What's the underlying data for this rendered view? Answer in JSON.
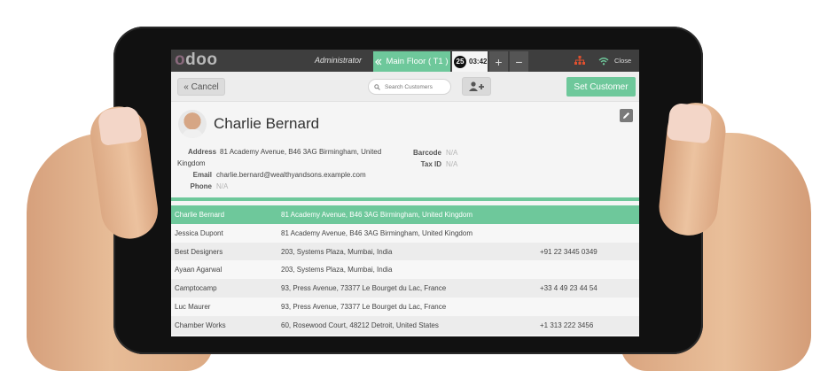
{
  "topbar": {
    "logo_a": "o",
    "logo_b": "doo",
    "user": "Administrator",
    "floor_tab": "Main Floor ( T1 )",
    "order_number": "25",
    "order_time": "03:42",
    "plus_label": "+",
    "minus_label": "−",
    "close_label": "Close"
  },
  "toolbar": {
    "cancel_label": "« Cancel",
    "search_placeholder": "Search Customers",
    "set_customer_label": "Set Customer"
  },
  "customer": {
    "name": "Charlie Bernard",
    "address_label": "Address",
    "address": "81 Academy Avenue, B46 3AG Birmingham, United Kingdom",
    "email_label": "Email",
    "email": "charlie.bernard@wealthyandsons.example.com",
    "phone_label": "Phone",
    "phone": "N/A",
    "barcode_label": "Barcode",
    "barcode": "N/A",
    "taxid_label": "Tax ID",
    "taxid": "N/A"
  },
  "customers": [
    {
      "name": "Charlie Bernard",
      "address": "81 Academy Avenue, B46 3AG Birmingham, United Kingdom",
      "phone": ""
    },
    {
      "name": "Jessica Dupont",
      "address": "81 Academy Avenue, B46 3AG Birmingham, United Kingdom",
      "phone": ""
    },
    {
      "name": "Best Designers",
      "address": "203, Systems Plaza, Mumbai, India",
      "phone": "+91 22 3445 0349"
    },
    {
      "name": "Ayaan Agarwal",
      "address": "203, Systems Plaza, Mumbai, India",
      "phone": ""
    },
    {
      "name": "Camptocamp",
      "address": "93, Press Avenue, 73377 Le Bourget du Lac, France",
      "phone": "+33 4 49 23 44 54"
    },
    {
      "name": "Luc Maurer",
      "address": "93, Press Avenue, 73377 Le Bourget du Lac, France",
      "phone": ""
    },
    {
      "name": "Chamber Works",
      "address": "60, Rosewood Court, 48212 Detroit, United States",
      "phone": "+1 313 222 3456"
    }
  ],
  "colors": {
    "accent": "#6ec89b",
    "topbar": "#3e3e3e",
    "network_icon": "#e0502f",
    "wifi_icon": "#6ec89b"
  },
  "icons": [
    "network-icon",
    "wifi-icon",
    "search-icon",
    "add-user-icon",
    "edit-icon",
    "chevron-left-icon"
  ]
}
